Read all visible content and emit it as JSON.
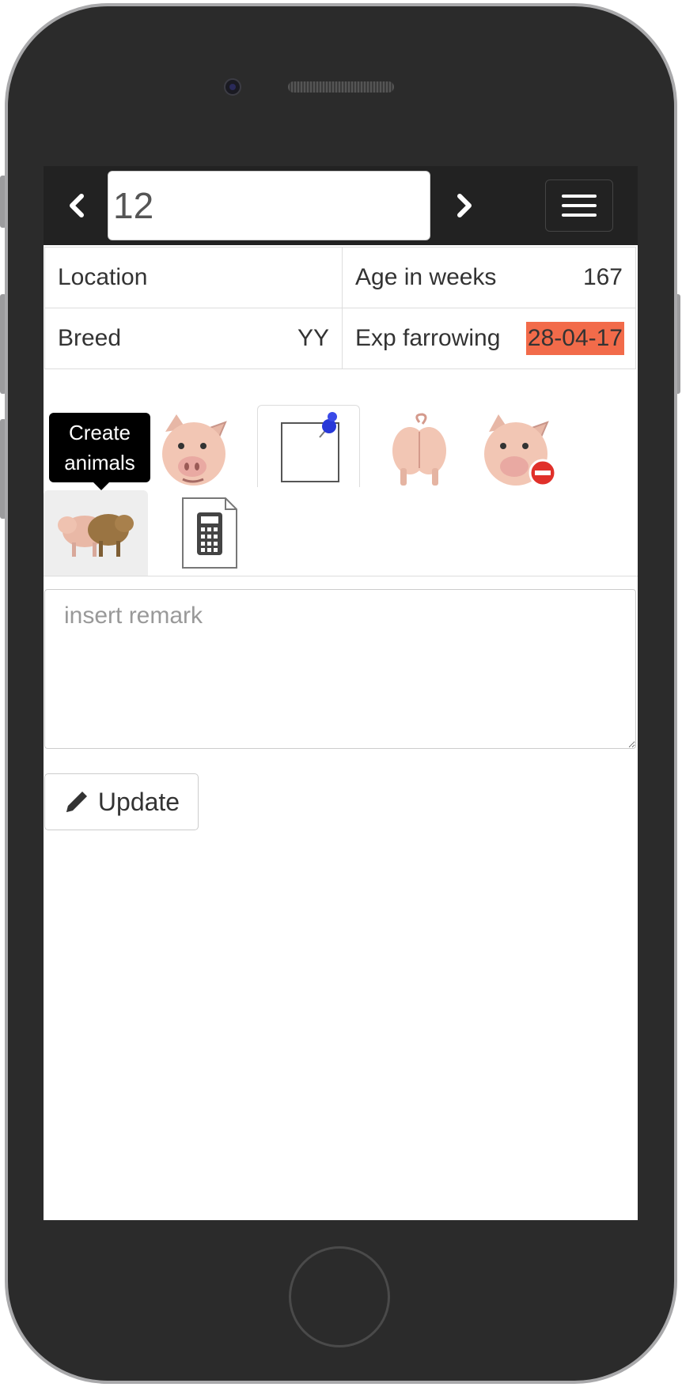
{
  "navbar": {
    "animal_number": "12",
    "prev_icon": "chevron-left-icon",
    "next_icon": "chevron-right-icon",
    "menu_icon": "hamburger-menu-icon"
  },
  "info": {
    "location_label": "Location",
    "location_value": "",
    "age_label": "Age in weeks",
    "age_value": "167",
    "breed_label": "Breed",
    "breed_value": "YY",
    "exp_farrowing_label": "Exp farrowing",
    "exp_farrowing_value": "28-04-17",
    "exp_farrowing_color": "#f26b4a"
  },
  "tabs": [
    {
      "icon": "calendar-icon",
      "tooltip_line1": "Create",
      "tooltip_line2": "animals"
    },
    {
      "icon": "pig-icon"
    },
    {
      "icon": "pinned-note-icon",
      "active": true
    },
    {
      "icon": "pig-rear-icon"
    },
    {
      "icon": "pig-remove-icon"
    },
    {
      "icon": "pig-group-icon"
    },
    {
      "icon": "calculator-icon"
    }
  ],
  "remark": {
    "placeholder": "insert remark",
    "value": ""
  },
  "update": {
    "label": "Update",
    "icon": "pencil-icon"
  }
}
